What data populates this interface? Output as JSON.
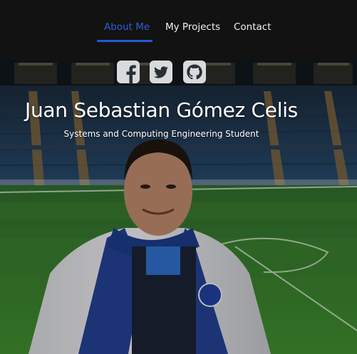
{
  "nav": {
    "items": [
      {
        "label": "About Me",
        "active": true
      },
      {
        "label": "My Projects",
        "active": false
      },
      {
        "label": "Contact",
        "active": false
      }
    ],
    "active_color": "#2f5fd6",
    "background": "#121212"
  },
  "hero": {
    "name": "Juan Sebastian Gómez Celis",
    "subtitle": "Systems and Computing Engineering Student",
    "social_icons": [
      "facebook-icon",
      "twitter-icon",
      "github-icon"
    ],
    "background_scene": "stadium photo"
  }
}
